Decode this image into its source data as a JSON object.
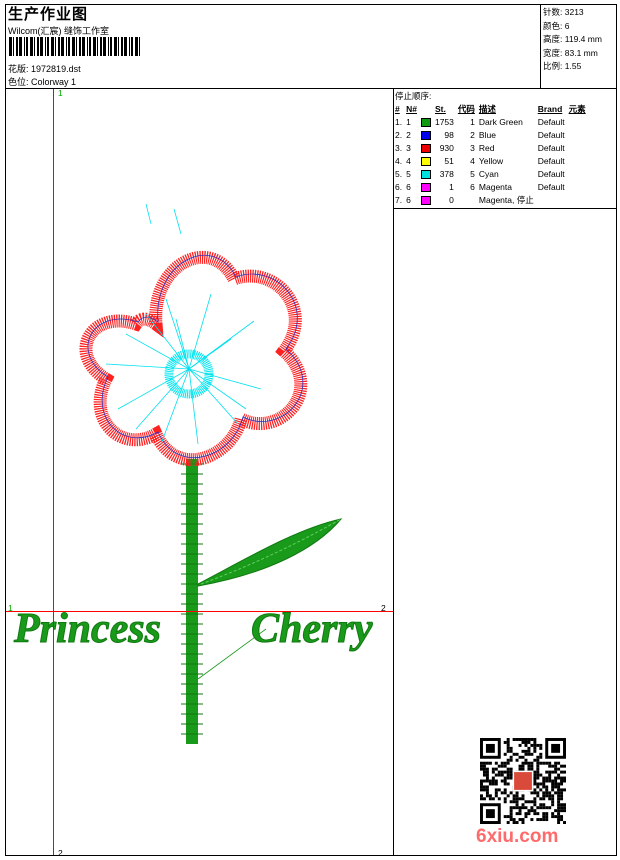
{
  "header": {
    "title": "生产作业图",
    "company": "Wilcom(汇宸) 缝饰工作室",
    "design_label": "花版:",
    "design_value": "1972819.dst",
    "colorway_label": "色位:",
    "colorway_value": "Colorway 1"
  },
  "stats": [
    {
      "label": "针数:",
      "value": "3213"
    },
    {
      "label": "颜色:",
      "value": "6"
    },
    {
      "label": "高度:",
      "value": "119.4 mm"
    },
    {
      "label": "宽度:",
      "value": "83.1 mm"
    },
    {
      "label": "比例:",
      "value": "1.55"
    }
  ],
  "stop_sequence": {
    "title": "停止顺序:",
    "columns": [
      "#",
      "N#",
      "St.",
      "代码",
      "描述",
      "Brand",
      "元素"
    ],
    "rows": [
      {
        "no": "1.",
        "n": "1",
        "color": "#109a10",
        "st": "1753",
        "code": "1",
        "desc": "Dark Green",
        "brand": "Default"
      },
      {
        "no": "2.",
        "n": "2",
        "color": "#0000ee",
        "st": "98",
        "code": "2",
        "desc": "Blue",
        "brand": "Default"
      },
      {
        "no": "3.",
        "n": "3",
        "color": "#ee0000",
        "st": "930",
        "code": "3",
        "desc": "Red",
        "brand": "Default"
      },
      {
        "no": "4.",
        "n": "4",
        "color": "#ffff00",
        "st": "51",
        "code": "4",
        "desc": "Yellow",
        "brand": "Default"
      },
      {
        "no": "5.",
        "n": "5",
        "color": "#00e0e0",
        "st": "378",
        "code": "5",
        "desc": "Cyan",
        "brand": "Default"
      },
      {
        "no": "6.",
        "n": "6",
        "color": "#ff00ff",
        "st": "1",
        "code": "6",
        "desc": "Magenta",
        "brand": "Default"
      },
      {
        "no": "7.",
        "n": "6",
        "color": "#ff00ff",
        "st": "0",
        "code": "",
        "desc": "Magenta, 停止",
        "brand": ""
      }
    ]
  },
  "markers": {
    "h_left": "1",
    "h_right": "2",
    "v_top": "1",
    "v_bottom": "2"
  },
  "artwork": {
    "word_left": "Princess",
    "word_right": "Cherry"
  },
  "watermark": "6xiu.com",
  "colors": {
    "green": "#1a9a1a",
    "red": "#ff2020",
    "cyan": "#00e6f0",
    "guide": "#ff0000"
  }
}
